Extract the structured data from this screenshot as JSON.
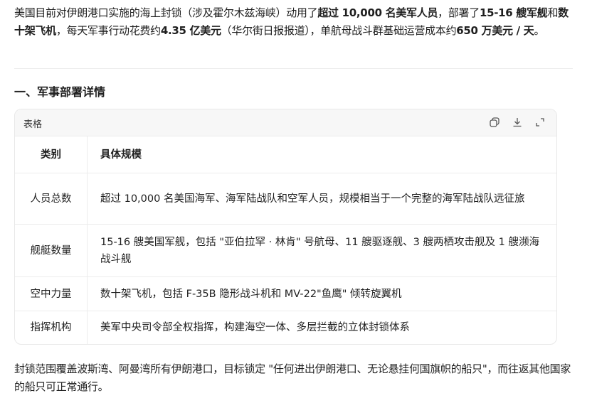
{
  "intro": {
    "s1": "美国目前对伊朗港口实施的海上封锁（涉及霍尔木兹海峡）动用了",
    "b1": "超过 10,000 名美军人员",
    "s2": "，部署了",
    "b2": "15-16 艘军舰",
    "s3": "和",
    "b3": "数十架飞机",
    "s4": "，每天军事行动花费约",
    "b4": "4.35 亿美元",
    "s5": "（华尔街日报报道），单航母战斗群基础运营成本约",
    "b5": "650 万美元 / 天",
    "s6": "。"
  },
  "section_title": "一、军事部署详情",
  "table": {
    "label": "表格",
    "headers": [
      "类别",
      "具体规模"
    ],
    "rows": [
      [
        "人员总数",
        "超过 10,000 名美国海军、海军陆战队和空军人员，规模相当于一个完整的海军陆战队远征旅"
      ],
      [
        "舰艇数量",
        "15-16 艘美国军舰，包括 \"亚伯拉罕 · 林肯\" 号航母、11 艘驱逐舰、3 艘两栖攻击舰及 1 艘濒海战斗舰"
      ],
      [
        "空中力量",
        "数十架飞机，包括 F-35B 隐形战斗机和 MV-22\"鱼鹰\" 倾转旋翼机"
      ],
      [
        "指挥机构",
        "美军中央司令部全权指挥，构建海空一体、多层拦截的立体封锁体系"
      ]
    ]
  },
  "outro": "封锁范围覆盖波斯湾、阿曼湾所有伊朗港口，目标锁定 \"任何进出伊朗港口、无论悬挂何国旗帜的船只\"，而往返其他国家的船只可正常通行。"
}
